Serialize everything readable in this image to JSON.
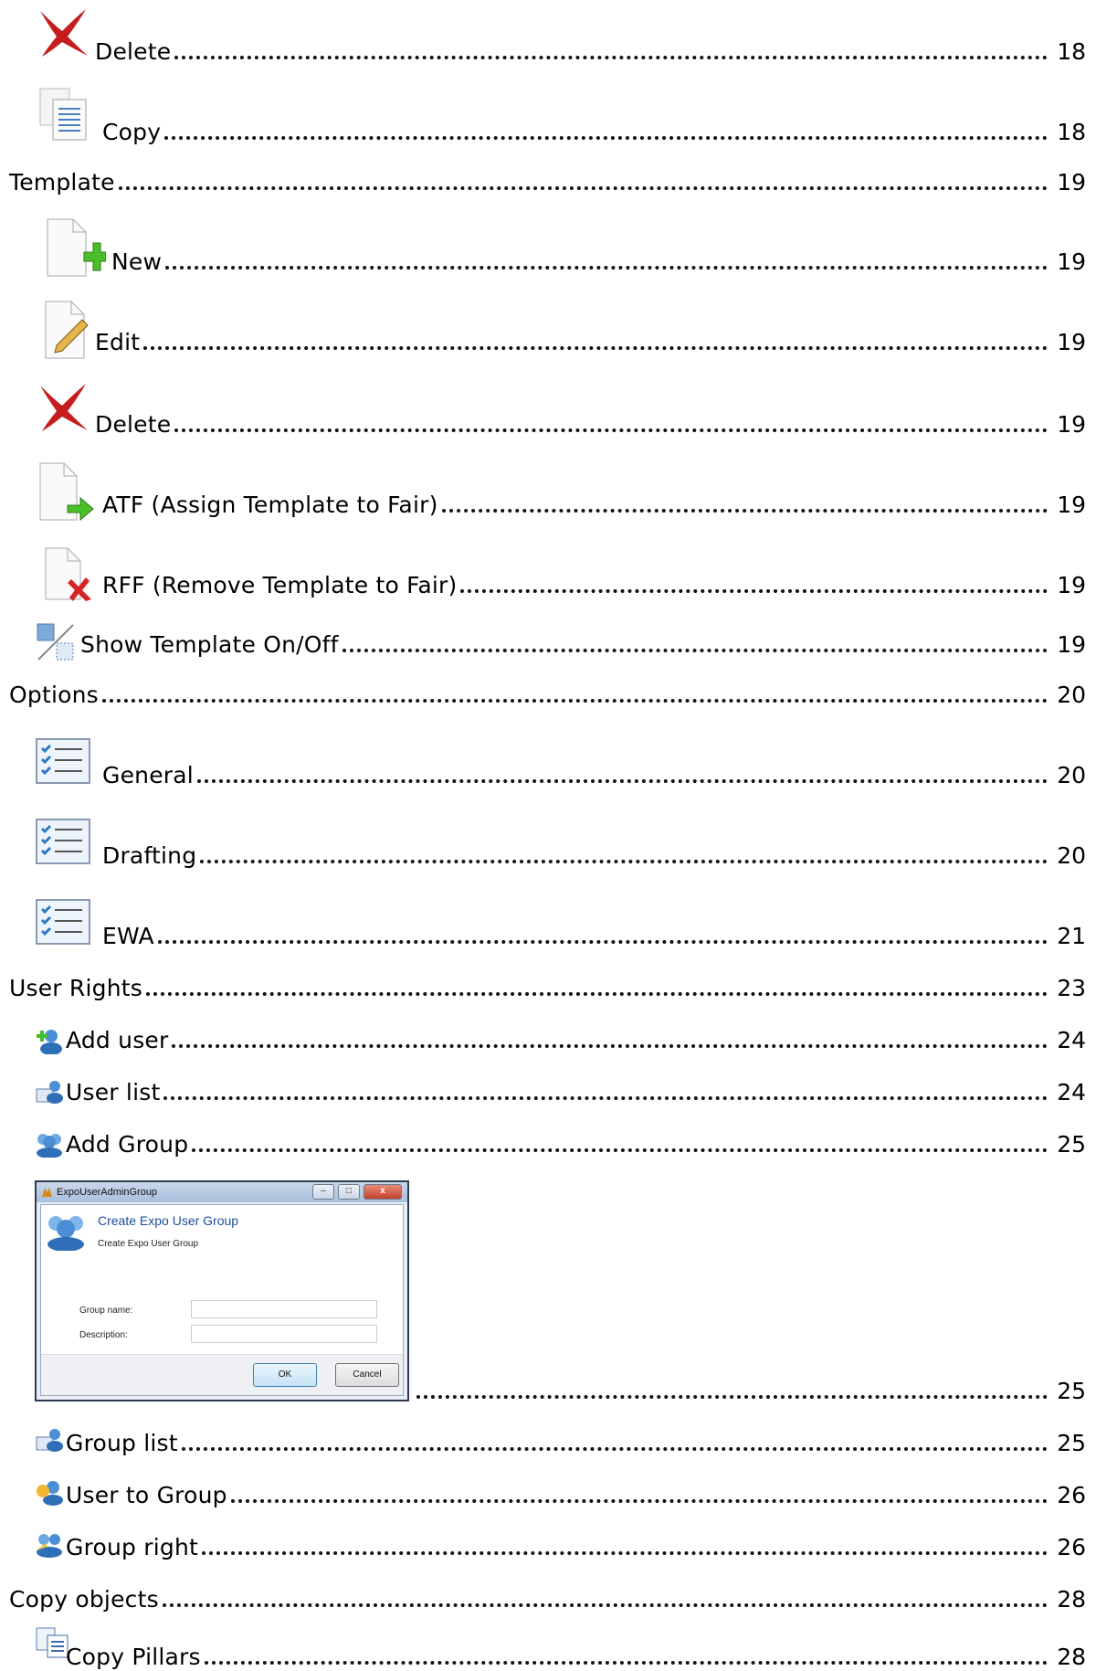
{
  "toc": [
    {
      "label": "Delete",
      "page": "18",
      "icon": "delete-x-icon"
    },
    {
      "label": "Copy",
      "page": "18",
      "icon": "copy-document-icon"
    },
    {
      "label": "Template",
      "page": "19",
      "icon": ""
    },
    {
      "label": "New",
      "page": "19",
      "icon": "new-document-plus-icon"
    },
    {
      "label": "Edit",
      "page": "19",
      "icon": "edit-document-pencil-icon"
    },
    {
      "label": "Delete",
      "page": "19",
      "icon": "delete-x-icon"
    },
    {
      "label": "ATF (Assign Template to Fair)",
      "page": "19",
      "icon": "assign-document-arrow-icon"
    },
    {
      "label": "RFF (Remove Template to Fair)",
      "page": "19",
      "icon": "remove-document-x-icon"
    },
    {
      "label": "Show Template On/Off",
      "page": "19",
      "icon": "show-template-toggle-icon"
    },
    {
      "label": "Options",
      "page": "20",
      "icon": ""
    },
    {
      "label": "General",
      "page": "20",
      "icon": "checklist-icon"
    },
    {
      "label": "Drafting",
      "page": "20",
      "icon": "checklist-icon"
    },
    {
      "label": "EWA",
      "page": "21",
      "icon": "checklist-icon"
    },
    {
      "label": "User Rights",
      "page": "23",
      "icon": ""
    },
    {
      "label": "Add user",
      "page": "24",
      "icon": "add-user-icon"
    },
    {
      "label": "User list",
      "page": "24",
      "icon": "user-list-icon"
    },
    {
      "label": "Add Group",
      "page": "25",
      "icon": "add-group-icon"
    },
    {
      "label": "",
      "page": "25",
      "icon": "dialog-screenshot"
    },
    {
      "label": "Group list",
      "page": "25",
      "icon": "group-list-icon"
    },
    {
      "label": "User to Group",
      "page": "26",
      "icon": "user-to-group-icon"
    },
    {
      "label": "Group right",
      "page": "26",
      "icon": "group-right-icon"
    },
    {
      "label": "Copy objects",
      "page": "28",
      "icon": ""
    },
    {
      "label": "Copy Pillars",
      "page": "28",
      "icon": "copy-pillars-icon"
    }
  ],
  "dialog": {
    "window_title": "ExpoUserAdminGroup",
    "heading": "Create Expo User Group",
    "subheading": "Create Expo User Group",
    "group_name_label": "Group name:",
    "description_label": "Description:",
    "ok_label": "OK",
    "cancel_label": "Cancel",
    "minimize_glyph": "–",
    "maximize_glyph": "□",
    "close_glyph": "x"
  }
}
